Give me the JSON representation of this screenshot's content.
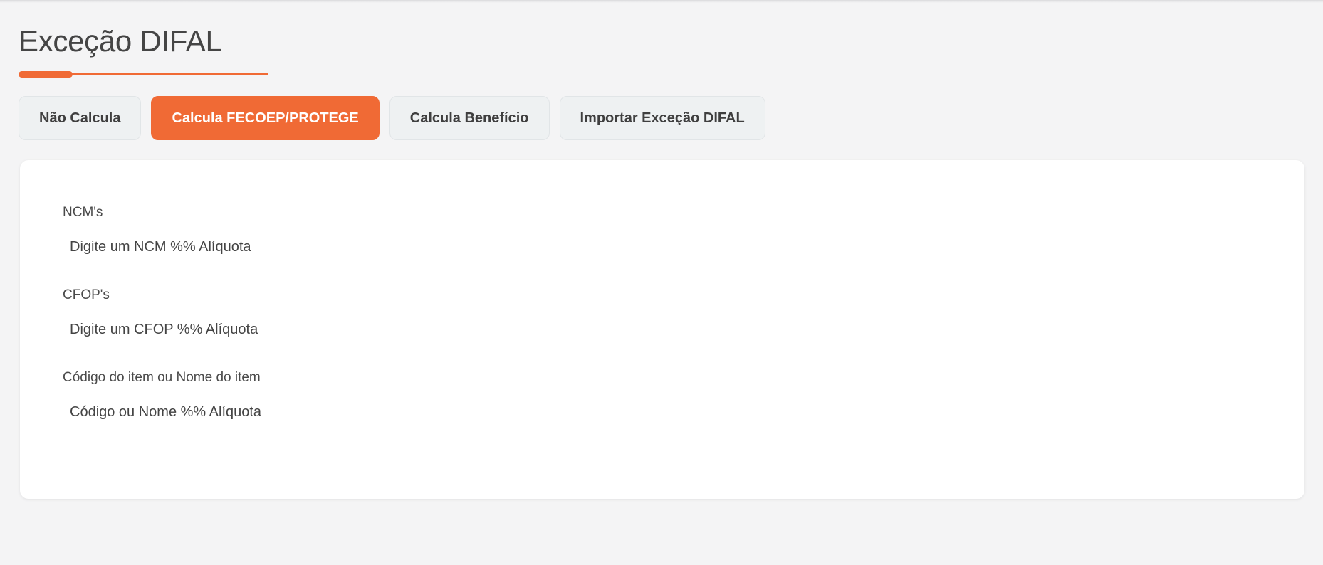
{
  "page": {
    "title": "Exceção DIFAL"
  },
  "tabs": [
    {
      "label": "Não Calcula",
      "active": false
    },
    {
      "label": "Calcula FECOEP/PROTEGE",
      "active": true
    },
    {
      "label": "Calcula Benefício",
      "active": false
    },
    {
      "label": "Importar Exceção DIFAL",
      "active": false
    }
  ],
  "form": {
    "ncm": {
      "label": "NCM's",
      "placeholder": "Digite um NCM %% Alíquota",
      "value": ""
    },
    "cfop": {
      "label": "CFOP's",
      "placeholder": "Digite um CFOP %% Alíquota",
      "value": ""
    },
    "item": {
      "label": "Código do item ou Nome do item",
      "placeholder": "Código ou Nome %% Alíquota",
      "value": ""
    }
  },
  "colors": {
    "accent": "#f06a35",
    "tab_background": "#eef1f2",
    "page_background": "#f4f4f5",
    "card_background": "#ffffff"
  }
}
